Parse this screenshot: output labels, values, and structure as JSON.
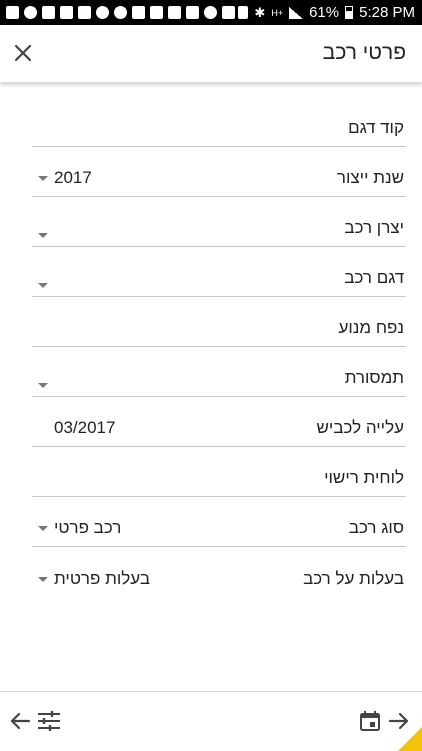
{
  "status_bar": {
    "battery": "61%",
    "time": "5:28 PM"
  },
  "header": {
    "title": "פרטי רכב"
  },
  "fields": [
    {
      "label": "קוד דגם",
      "value": "",
      "dropdown": false
    },
    {
      "label": "שנת ייצור",
      "value": "2017",
      "dropdown": true
    },
    {
      "label": "יצרן רכב",
      "value": "",
      "dropdown": true
    },
    {
      "label": "דגם רכב",
      "value": "",
      "dropdown": true
    },
    {
      "label": "נפח מנוע",
      "value": "",
      "dropdown": false
    },
    {
      "label": "תמסורת",
      "value": "",
      "dropdown": true
    },
    {
      "label": "עלייה לכביש",
      "value": "03/2017",
      "dropdown": false
    },
    {
      "label": "לוחית רישוי",
      "value": "",
      "dropdown": false
    },
    {
      "label": "סוג רכב",
      "value": "רכב פרטי",
      "dropdown": true
    },
    {
      "label": "בעלות על רכב",
      "value": "בעלות פרטית",
      "dropdown": true
    }
  ],
  "bottom_bar": {
    "icons": [
      "back-arrow-icon",
      "filter-sliders-icon",
      "calendar-icon",
      "forward-arrow-icon"
    ],
    "accent_color": "#f4c20d"
  }
}
